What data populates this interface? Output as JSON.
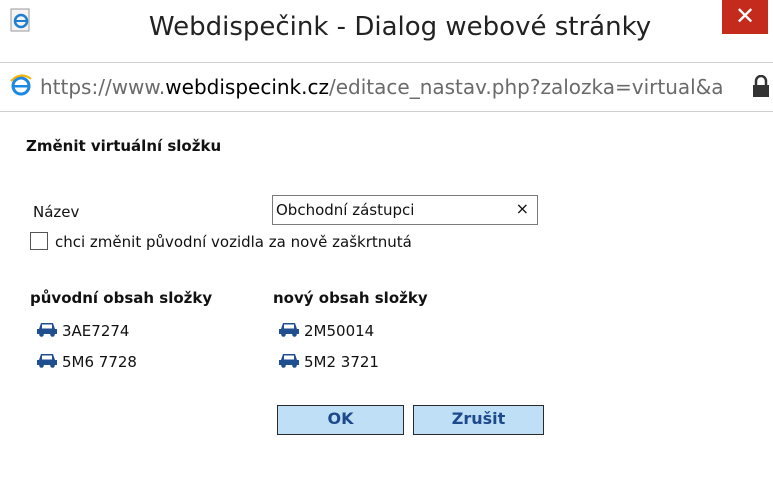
{
  "window": {
    "title": "Webdispečink - Dialog webové stránky",
    "close_glyph": "✕",
    "app_icon": "ie-icon"
  },
  "address": {
    "scheme": "https://www.",
    "domain": "webdispecink.cz",
    "path": "/editace_nastav.php?zalozka=virtual&a",
    "icon": "lock-icon"
  },
  "form": {
    "heading": "Změnit virtuální složku",
    "name_label": "Název",
    "name_value": "Obchodní zástupci",
    "clear_glyph": "×",
    "checkbox_label": "chci změnit původní vozidla za nově zaškrtnutá",
    "checkbox_checked": false
  },
  "original": {
    "heading": "původní obsah složky",
    "vehicles": [
      "3AE7274",
      "5M6 7728"
    ]
  },
  "new": {
    "heading": "nový obsah složky",
    "vehicles": [
      "2M50014",
      "5M2 3721"
    ]
  },
  "buttons": {
    "ok": "OK",
    "cancel": "Zrušit"
  },
  "colors": {
    "close_bg": "#c42b1c",
    "button_bg": "#bfdff7",
    "button_text": "#1c4a8c",
    "car_icon": "#1f4f8f"
  }
}
